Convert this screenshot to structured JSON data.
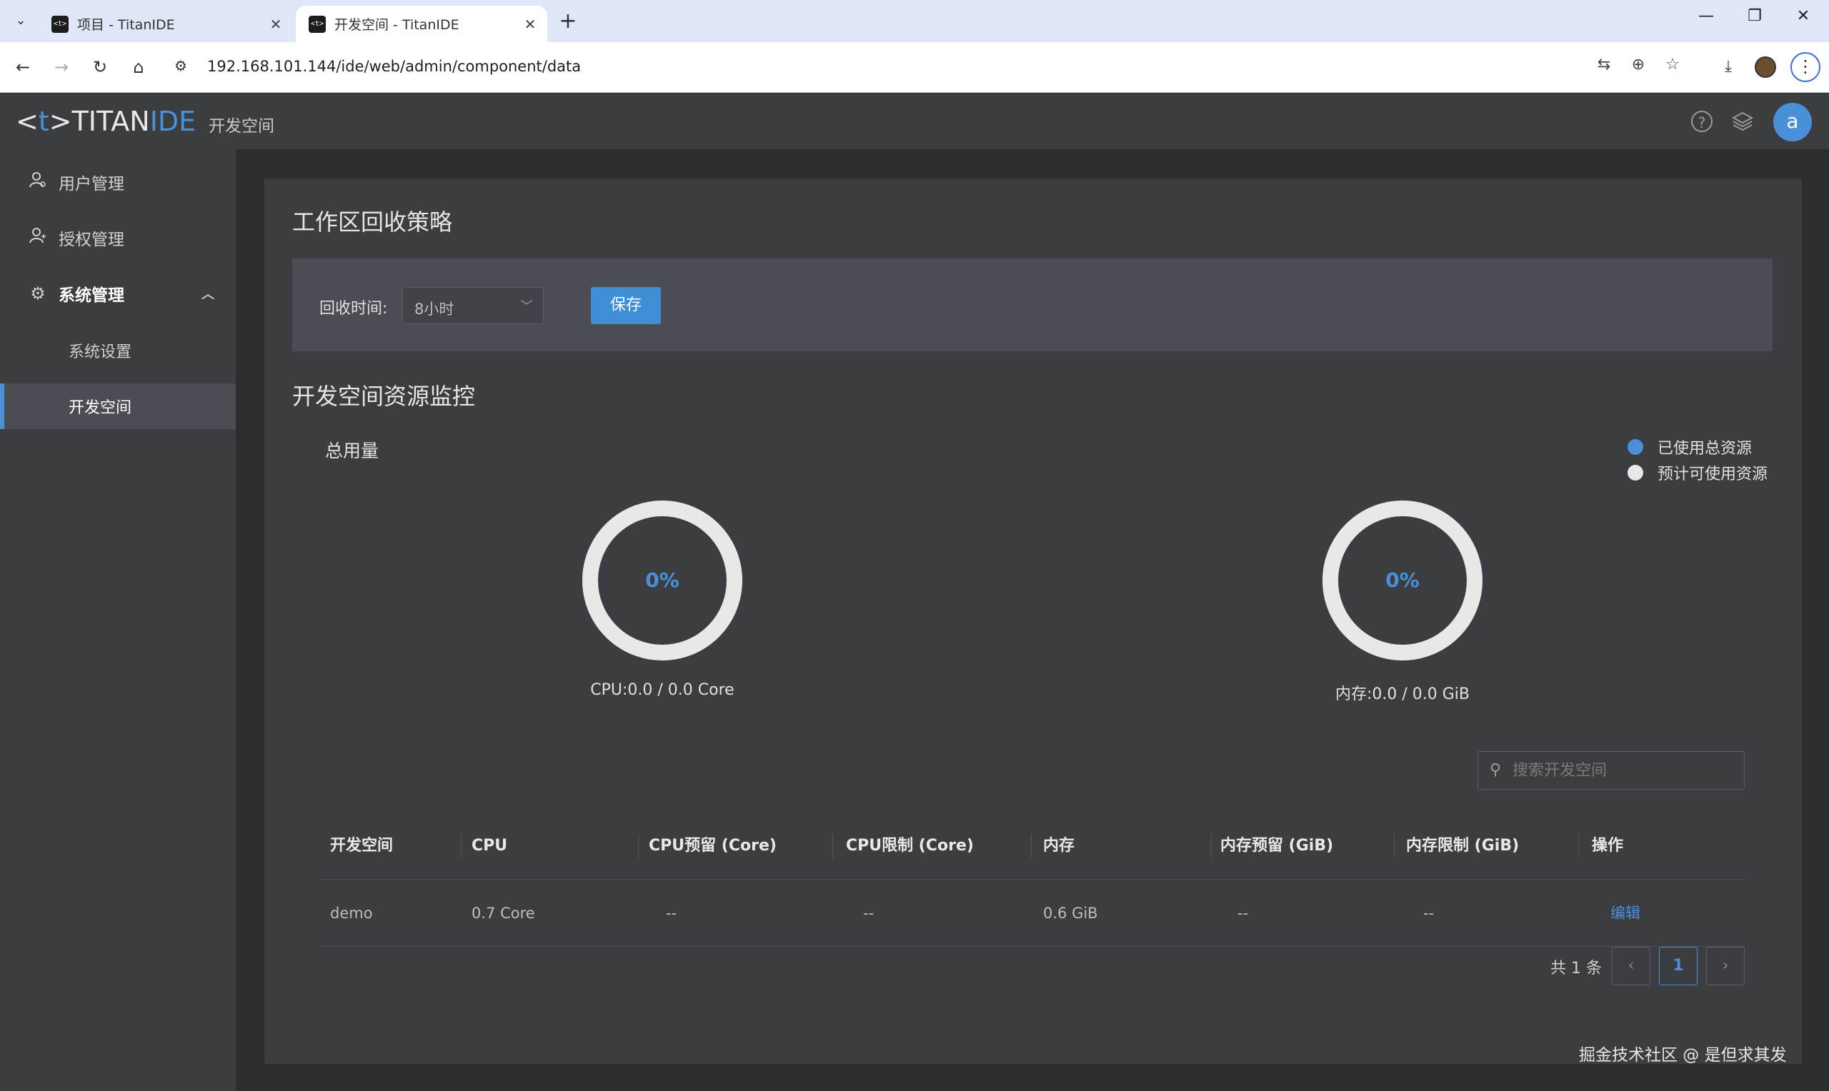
{
  "browser": {
    "tabs": [
      {
        "title": "项目 - TitanIDE",
        "active": false
      },
      {
        "title": "开发空间 - TitanIDE",
        "active": true
      }
    ],
    "url": "192.168.101.144/ide/web/admin/component/data"
  },
  "header": {
    "logo_left": "<",
    "logo_t": "t",
    "logo_right": ">",
    "logo_titan": "TITAN",
    "logo_ide": "IDE",
    "section": "开发空间",
    "avatar_letter": "a"
  },
  "sidebar": {
    "items": [
      {
        "label": "用户管理",
        "icon": "user-manage-icon"
      },
      {
        "label": "授权管理",
        "icon": "auth-icon"
      },
      {
        "label": "系统管理",
        "icon": "gear-icon"
      },
      {
        "label": "系统设置"
      },
      {
        "label": "开发空间",
        "active": true
      }
    ]
  },
  "policy": {
    "title": "工作区回收策略",
    "label": "回收时间:",
    "value": "8小时",
    "save": "保存"
  },
  "monitor": {
    "title": "开发空间资源监控",
    "usage_label": "总用量",
    "legend": [
      {
        "label": "已使用总资源",
        "color": "#4a90d9"
      },
      {
        "label": "预计可使用资源",
        "color": "#e8e8e8"
      }
    ],
    "cpu": {
      "percent_text": "0%",
      "percent": 0,
      "label": "CPU:0.0 / 0.0 Core"
    },
    "memory": {
      "percent_text": "0%",
      "percent": 0,
      "label": "内存:0.0 / 0.0 GiB"
    }
  },
  "search": {
    "placeholder": "搜索开发空间"
  },
  "table": {
    "headers": [
      "开发空间",
      "CPU",
      "CPU预留 (Core)",
      "CPU限制 (Core)",
      "内存",
      "内存预留 (GiB)",
      "内存限制 (GiB)",
      "操作"
    ],
    "rows": [
      [
        "demo",
        "0.7 Core",
        "--",
        "--",
        "0.6 GiB",
        "--",
        "--",
        "编辑"
      ]
    ]
  },
  "pagination": {
    "total": "共 1 条",
    "current": "1",
    "prev": "‹",
    "next": "›"
  },
  "watermark": "掘金技术社区 @ 是但求其发",
  "colors": {
    "accent": "#4a90d9",
    "panel": "#3b3d41",
    "background": "#2b2d30"
  }
}
